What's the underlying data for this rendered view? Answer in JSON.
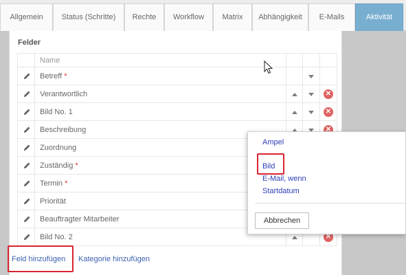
{
  "tabs": [
    {
      "label": "Allgemein",
      "active": false
    },
    {
      "label": "Status (Schritte)",
      "active": false
    },
    {
      "label": "Rechte",
      "active": false
    },
    {
      "label": "Workflow",
      "active": false
    },
    {
      "label": "Matrix",
      "active": false
    },
    {
      "label": "Abhängigkeit",
      "active": false
    },
    {
      "label": "E-Mails",
      "active": false
    },
    {
      "label": "Aktivität",
      "active": true
    }
  ],
  "panel": {
    "title": "Felder",
    "column_name": "Name",
    "required_marker": "*",
    "rows": [
      {
        "name": "Betreff",
        "required": true,
        "up": false,
        "down": true,
        "delete": false
      },
      {
        "name": "Verantwortlich",
        "required": false,
        "up": true,
        "down": true,
        "delete": true
      },
      {
        "name": "Bild No. 1",
        "required": false,
        "up": true,
        "down": true,
        "delete": true
      },
      {
        "name": "Beschreibung",
        "required": false,
        "up": true,
        "down": true,
        "delete": true
      },
      {
        "name": "Zuordnung",
        "required": false,
        "up": false,
        "down": false,
        "delete": false
      },
      {
        "name": "Zuständig",
        "required": true,
        "up": false,
        "down": false,
        "delete": false
      },
      {
        "name": "Termin",
        "required": true,
        "up": false,
        "down": false,
        "delete": false
      },
      {
        "name": "Priorität",
        "required": false,
        "up": false,
        "down": false,
        "delete": false
      },
      {
        "name": "Beauftragter Mitarbeiter",
        "required": false,
        "up": false,
        "down": false,
        "delete": false
      },
      {
        "name": "Bild No. 2",
        "required": false,
        "up": true,
        "down": false,
        "delete": true
      }
    ],
    "add_field_link": "Feld hinzufügen",
    "add_category_link": "Kategorie hinzufügen"
  },
  "popup": {
    "items": [
      "Ampel",
      "Bild",
      "E-Mail, wenn",
      "Startdatum"
    ],
    "cancel_label": "Abbrechen"
  },
  "colors": {
    "active_tab": "#78aed0",
    "link": "#3a5fb0",
    "delete_icon": "#e06262",
    "highlight": "#d9232e",
    "required_marker": "#dd3333"
  }
}
